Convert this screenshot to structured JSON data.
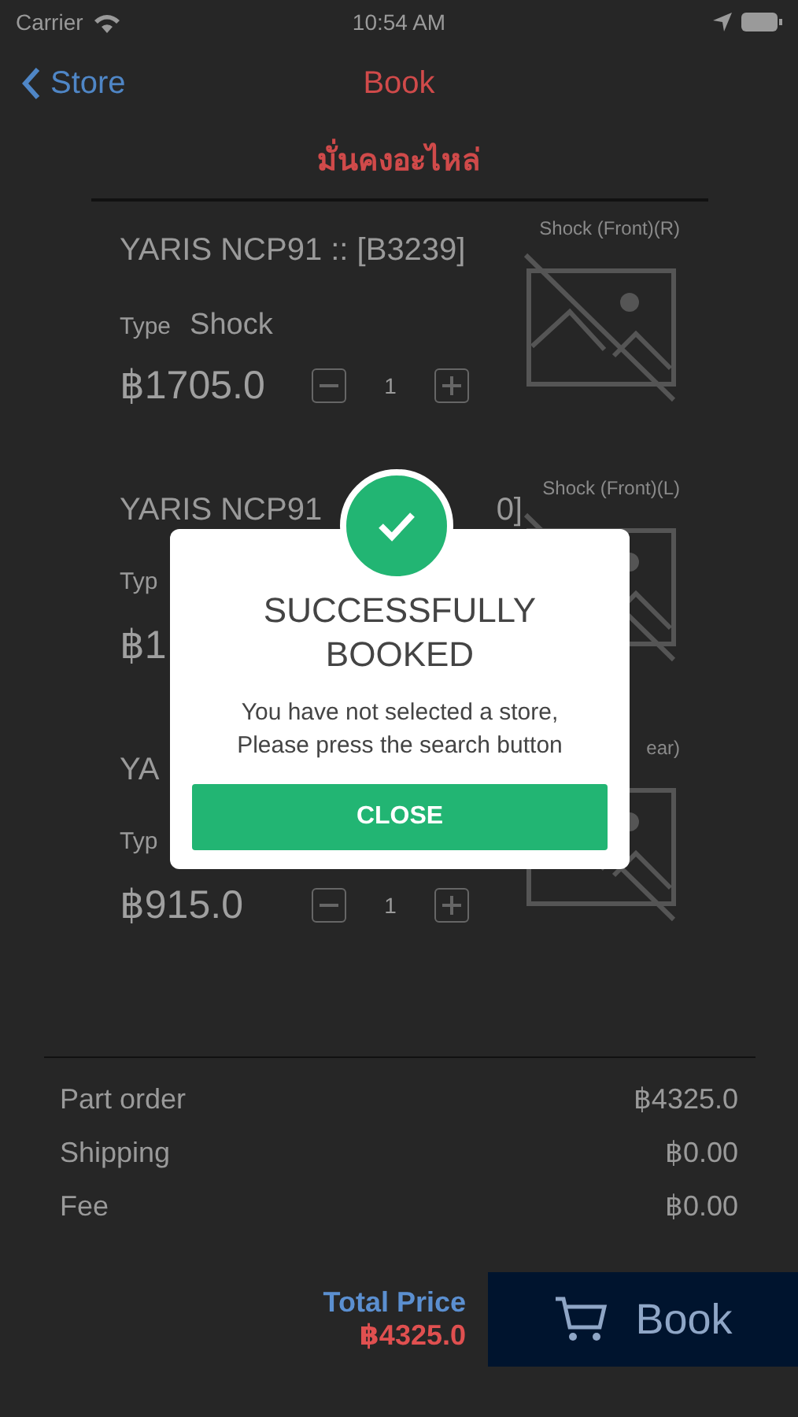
{
  "status_bar": {
    "carrier": "Carrier",
    "time": "10:54 AM"
  },
  "nav": {
    "back": "Store",
    "title": "Book"
  },
  "shop_name": "มั่นคงอะไหล่",
  "items": [
    {
      "title": "YARIS NCP91 :: [B3239]",
      "type_label": "Type",
      "type": "Shock",
      "price": "฿1705.0",
      "qty": "1",
      "image_label": "Shock (Front)(R)"
    },
    {
      "title": "YARIS NCP91",
      "title_tail": "0]",
      "type_label": "Typ",
      "price": "฿1",
      "image_label": "Shock (Front)(L)"
    },
    {
      "title": "YA",
      "type_label": "Typ",
      "price": "฿915.0",
      "qty": "1",
      "image_label": "ear)"
    }
  ],
  "summary": [
    {
      "label": "Part order",
      "value": "฿4325.0"
    },
    {
      "label": "Shipping",
      "value": "฿0.00"
    },
    {
      "label": "Fee",
      "value": "฿0.00"
    }
  ],
  "total": {
    "label": "Total Price",
    "value": "฿4325.0"
  },
  "book_button": "Book",
  "dialog": {
    "title": "SUCCESSFULLY BOOKED",
    "message": "You have not selected a store, Please press the search button",
    "button": "CLOSE"
  }
}
